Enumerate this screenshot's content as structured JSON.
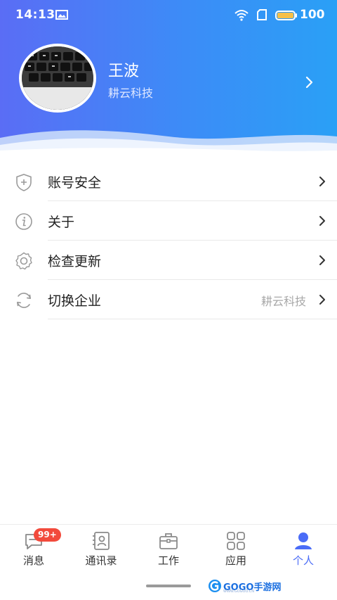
{
  "status_bar": {
    "time": "14:13",
    "battery": "100"
  },
  "profile": {
    "name": "王波",
    "company": "耕云科技"
  },
  "menu": [
    {
      "label": "账号安全",
      "value": "",
      "icon": "shield-plus-icon"
    },
    {
      "label": "关于",
      "value": "",
      "icon": "info-icon"
    },
    {
      "label": "检查更新",
      "value": "",
      "icon": "gear-icon"
    },
    {
      "label": "切换企业",
      "value": "耕云科技",
      "icon": "refresh-icon"
    }
  ],
  "tabs": [
    {
      "label": "消息",
      "icon": "message-icon",
      "badge": "99+"
    },
    {
      "label": "通讯录",
      "icon": "contacts-icon"
    },
    {
      "label": "工作",
      "icon": "briefcase-icon"
    },
    {
      "label": "应用",
      "icon": "apps-grid-icon"
    },
    {
      "label": "个人",
      "icon": "person-icon",
      "active": true
    }
  ],
  "colors": {
    "accent": "#4a6cf7",
    "badge": "#f24a3c",
    "header_start": "#5a6df5",
    "header_end": "#2aa0f6"
  },
  "watermark": {
    "text": "GOGO手游网",
    "sub": "WWW.GOGOO.CN"
  }
}
